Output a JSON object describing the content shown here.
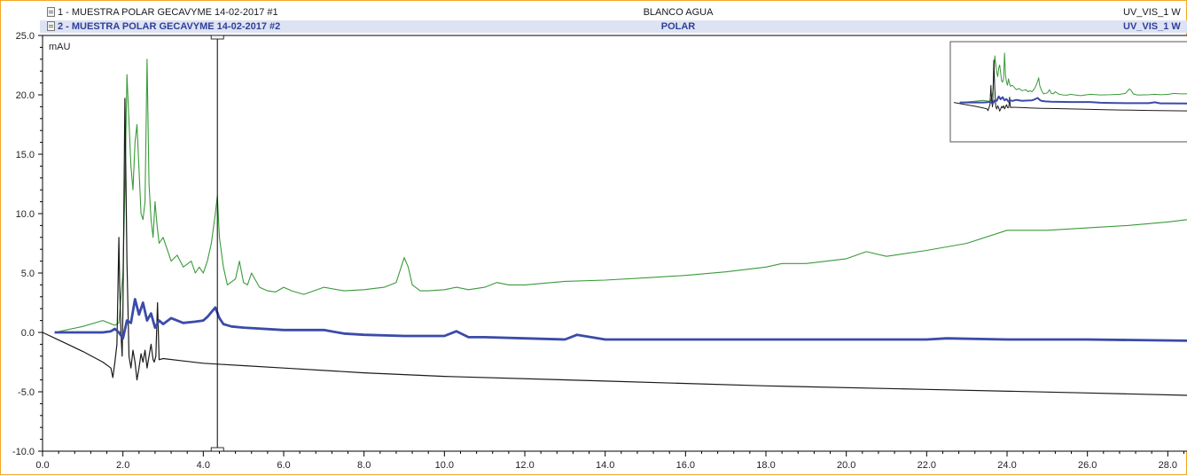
{
  "legend": [
    {
      "index": "1",
      "name": "1 - MUESTRA POLAR GECAVYME 14-02-2017 #1",
      "sample": "BLANCO AGUA",
      "channel": "UV_VIS_1 W"
    },
    {
      "index": "2",
      "name": "2 - MUESTRA POLAR GECAVYME 14-02-2017 #2",
      "sample": "POLAR",
      "channel": "UV_VIS_1 W"
    }
  ],
  "colors": {
    "frame": "#f5a623",
    "series_blanco": "#1a1a1a",
    "series_polar": "#3b4ba8",
    "series_green": "#3a9a3a",
    "header_selected_bg": "#dde3f2"
  },
  "chart_data": {
    "type": "line",
    "ylabel": "mAU",
    "xlim": [
      0,
      28.5
    ],
    "ylim": [
      -10,
      25
    ],
    "xticks": [
      "0.0",
      "2.0",
      "4.0",
      "6.0",
      "8.0",
      "10.0",
      "12.0",
      "14.0",
      "16.0",
      "18.0",
      "20.0",
      "22.0",
      "24.0",
      "26.0",
      "28.0"
    ],
    "yticks": [
      "-10.0",
      "-5.0",
      "0.0",
      "5.0",
      "10.0",
      "15.0",
      "20.0",
      "25.0"
    ],
    "cursor_x": 4.35,
    "inset": true,
    "series": [
      {
        "name": "1 - MUESTRA POLAR GECAVYME 14-02-2017 #1",
        "color": "#1a1a1a",
        "x": [
          0.0,
          0.5,
          1.0,
          1.5,
          1.7,
          1.75,
          1.8,
          1.85,
          1.9,
          1.92,
          1.95,
          1.98,
          2.0,
          2.05,
          2.1,
          2.15,
          2.2,
          2.25,
          2.3,
          2.35,
          2.4,
          2.45,
          2.5,
          2.55,
          2.6,
          2.65,
          2.7,
          2.75,
          2.78,
          2.82,
          2.86,
          2.9,
          3.0,
          3.5,
          4.0,
          4.5,
          5.0,
          6.0,
          8.0,
          10.0,
          14.0,
          18.0,
          22.0,
          26.0,
          28.5
        ],
        "y": [
          0.0,
          -0.8,
          -1.6,
          -2.5,
          -3.0,
          -3.8,
          -2.5,
          -1.0,
          8.0,
          4.0,
          0.0,
          -2.0,
          2.0,
          19.7,
          6.0,
          -2.0,
          -3.0,
          -1.5,
          -2.5,
          -4.0,
          -3.0,
          -1.8,
          -2.5,
          -1.5,
          -3.0,
          -2.0,
          -1.0,
          -2.3,
          -2.5,
          -2.0,
          2.5,
          -2.3,
          -2.2,
          -2.4,
          -2.6,
          -2.7,
          -2.8,
          -3.0,
          -3.4,
          -3.7,
          -4.1,
          -4.5,
          -4.8,
          -5.1,
          -5.3
        ]
      },
      {
        "name": "2 - MUESTRA POLAR GECAVYME 14-02-2017 #2",
        "color": "#3b4ba8",
        "x": [
          0.3,
          1.5,
          1.7,
          1.8,
          1.9,
          2.0,
          2.1,
          2.2,
          2.3,
          2.4,
          2.5,
          2.6,
          2.7,
          2.8,
          2.9,
          3.0,
          3.2,
          3.5,
          3.8,
          4.0,
          4.1,
          4.2,
          4.3,
          4.4,
          4.5,
          4.7,
          5.0,
          6.0,
          7.0,
          7.5,
          8.0,
          9.0,
          10.0,
          10.3,
          10.6,
          11.0,
          12.0,
          13.0,
          13.3,
          14.0,
          16.0,
          18.0,
          20.0,
          22.0,
          22.5,
          24.0,
          26.0,
          28.5
        ],
        "y": [
          0.0,
          0.0,
          0.1,
          0.3,
          0.0,
          -0.5,
          1.0,
          0.8,
          2.8,
          1.5,
          2.5,
          1.0,
          1.6,
          0.4,
          1.0,
          0.7,
          1.2,
          0.8,
          0.9,
          1.0,
          1.3,
          1.7,
          2.1,
          1.2,
          0.7,
          0.5,
          0.4,
          0.2,
          0.2,
          -0.1,
          -0.2,
          -0.3,
          -0.3,
          0.1,
          -0.4,
          -0.4,
          -0.5,
          -0.6,
          -0.2,
          -0.6,
          -0.6,
          -0.6,
          -0.6,
          -0.6,
          -0.5,
          -0.6,
          -0.6,
          -0.7
        ]
      },
      {
        "name": "",
        "color": "#3a9a3a",
        "x": [
          0.3,
          1.0,
          1.5,
          1.8,
          1.9,
          2.0,
          2.05,
          2.1,
          2.2,
          2.25,
          2.3,
          2.35,
          2.45,
          2.5,
          2.55,
          2.6,
          2.65,
          2.7,
          2.75,
          2.8,
          2.85,
          2.9,
          3.0,
          3.2,
          3.35,
          3.5,
          3.7,
          3.8,
          3.9,
          4.0,
          4.1,
          4.2,
          4.3,
          4.35,
          4.4,
          4.5,
          4.6,
          4.8,
          4.9,
          5.0,
          5.1,
          5.2,
          5.4,
          5.6,
          5.8,
          6.0,
          6.2,
          6.5,
          7.0,
          7.5,
          8.0,
          8.5,
          8.8,
          9.0,
          9.1,
          9.2,
          9.4,
          9.6,
          10.0,
          10.3,
          10.6,
          11.0,
          11.3,
          11.6,
          12.0,
          13.0,
          14.0,
          15.0,
          16.0,
          17.0,
          18.0,
          18.4,
          19.0,
          20.0,
          20.5,
          21.0,
          22.0,
          23.0,
          24.0,
          24.5,
          25.0,
          26.0,
          27.0,
          28.0,
          28.5
        ],
        "y": [
          0.0,
          0.5,
          1.0,
          0.6,
          0.8,
          5.0,
          12.0,
          21.7,
          14.0,
          12.0,
          16.0,
          17.5,
          10.0,
          9.5,
          11.0,
          23.0,
          12.5,
          9.5,
          8.0,
          11.0,
          9.0,
          7.5,
          8.0,
          6.0,
          6.5,
          5.5,
          6.0,
          5.0,
          5.5,
          5.0,
          6.0,
          7.5,
          10.0,
          11.5,
          8.0,
          5.5,
          4.0,
          4.5,
          6.0,
          4.2,
          4.0,
          5.0,
          3.8,
          3.5,
          3.4,
          3.8,
          3.5,
          3.2,
          3.8,
          3.5,
          3.6,
          3.8,
          4.2,
          6.3,
          5.5,
          4.0,
          3.5,
          3.5,
          3.6,
          3.8,
          3.6,
          3.8,
          4.2,
          4.0,
          4.0,
          4.3,
          4.4,
          4.6,
          4.8,
          5.1,
          5.5,
          5.8,
          5.8,
          6.2,
          6.8,
          6.4,
          6.9,
          7.5,
          8.6,
          8.6,
          8.6,
          8.8,
          9.0,
          9.3,
          9.5
        ]
      }
    ]
  }
}
